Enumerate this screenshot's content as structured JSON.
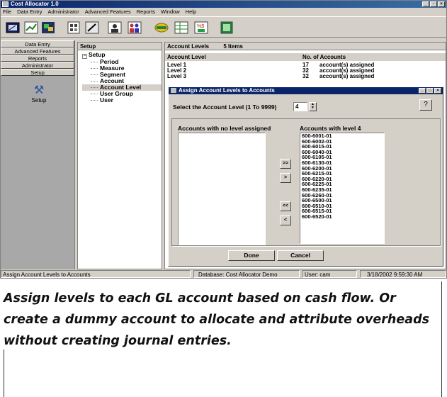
{
  "window": {
    "title": "Cost Allocator 1.0"
  },
  "menu": [
    "File",
    "Data Entry",
    "Administrator",
    "Advanced Features",
    "Reports",
    "Window",
    "Help"
  ],
  "toolbar": {
    "icons": [
      "data-entry-icon",
      "chart-icon",
      "window-icon",
      "grid-icon",
      "edit-icon",
      "user-icon",
      "people-icon",
      "money-icon",
      "table-icon",
      "allocate-icon",
      "report-icon"
    ]
  },
  "nav": {
    "items": [
      "Data Entry",
      "Advanced Features",
      "Reports",
      "Administrator",
      "Setup"
    ],
    "selected_label": "Setup"
  },
  "tree": {
    "header": "Setup",
    "root": "Setup",
    "children": [
      "Period",
      "Measure",
      "Segment",
      "Account",
      "Account Level",
      "User Group",
      "User"
    ],
    "selected": "Account Level"
  },
  "levels": {
    "header_title": "Account Levels",
    "header_count": "5 Items",
    "col_level": "Account Level",
    "col_count": "No. of Accounts",
    "rows": [
      {
        "level": "Level  1",
        "count": "17",
        "text": "account(s) assigned"
      },
      {
        "level": "Level  2",
        "count": "32",
        "text": "account(s) assigned"
      },
      {
        "level": "Level  3",
        "count": "32",
        "text": "account(s) assigned"
      }
    ]
  },
  "dialog": {
    "title": "Assign Account Levels to Accounts",
    "select_label": "Select the Account Level (1 To 9999)",
    "level_value": "4",
    "left_list_label": "Accounts with no level assigned",
    "right_list_label": "Accounts with level 4",
    "accounts": [
      "600-6001-01",
      "600-6002-01",
      "600-6015-01",
      "600-6040-01",
      "600-6105-01",
      "600-6130-01",
      "600-6200-01",
      "600-6215-01",
      "600-6220-01",
      "600-6225-01",
      "600-6235-01",
      "600-6260-01",
      "600-6500-01",
      "600-6510-01",
      "600-6515-01",
      "600-6520-01"
    ],
    "move_all_right": ">>",
    "move_right": ">",
    "move_all_left": "<<",
    "move_left": "<",
    "done_label": "Done",
    "cancel_label": "Cancel"
  },
  "status": {
    "action": "Assign Account Levels to Accounts",
    "database": "Database:  Cost Allocator Demo",
    "user": "User: cam",
    "datetime": "3/18/2002 9:59:30 AM"
  },
  "caption": "Assign levels to each GL account based on cash flow. Or create a dummy account to allocate and attribute overheads without creating journal entries."
}
